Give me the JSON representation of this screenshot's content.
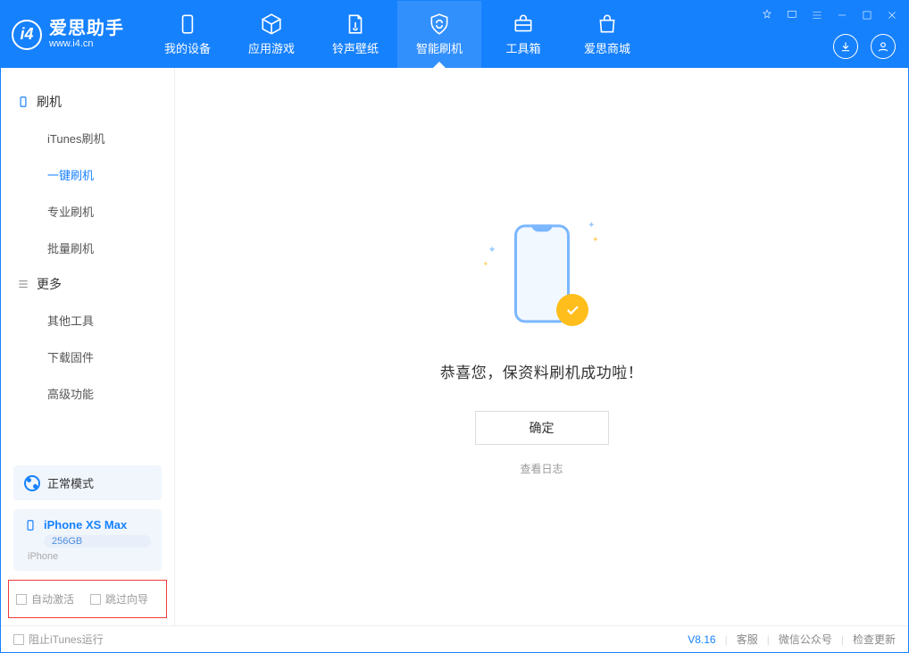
{
  "app": {
    "title": "爱思助手",
    "subtitle": "www.i4.cn"
  },
  "nav": {
    "items": [
      {
        "label": "我的设备"
      },
      {
        "label": "应用游戏"
      },
      {
        "label": "铃声壁纸"
      },
      {
        "label": "智能刷机"
      },
      {
        "label": "工具箱"
      },
      {
        "label": "爱思商城"
      }
    ]
  },
  "sidebar": {
    "group_flash": "刷机",
    "items_flash": [
      {
        "label": "iTunes刷机"
      },
      {
        "label": "一键刷机"
      },
      {
        "label": "专业刷机"
      },
      {
        "label": "批量刷机"
      }
    ],
    "group_more": "更多",
    "items_more": [
      {
        "label": "其他工具"
      },
      {
        "label": "下载固件"
      },
      {
        "label": "高级功能"
      }
    ],
    "mode": "正常模式",
    "device": {
      "name": "iPhone XS Max",
      "storage": "256GB",
      "type": "iPhone"
    },
    "auto_activate": "自动激活",
    "skip_guide": "跳过向导"
  },
  "main": {
    "success_text": "恭喜您，保资料刷机成功啦！",
    "ok_button": "确定",
    "view_log": "查看日志"
  },
  "footer": {
    "block_itunes": "阻止iTunes运行",
    "version": "V8.16",
    "support": "客服",
    "wechat": "微信公众号",
    "update": "检查更新"
  }
}
